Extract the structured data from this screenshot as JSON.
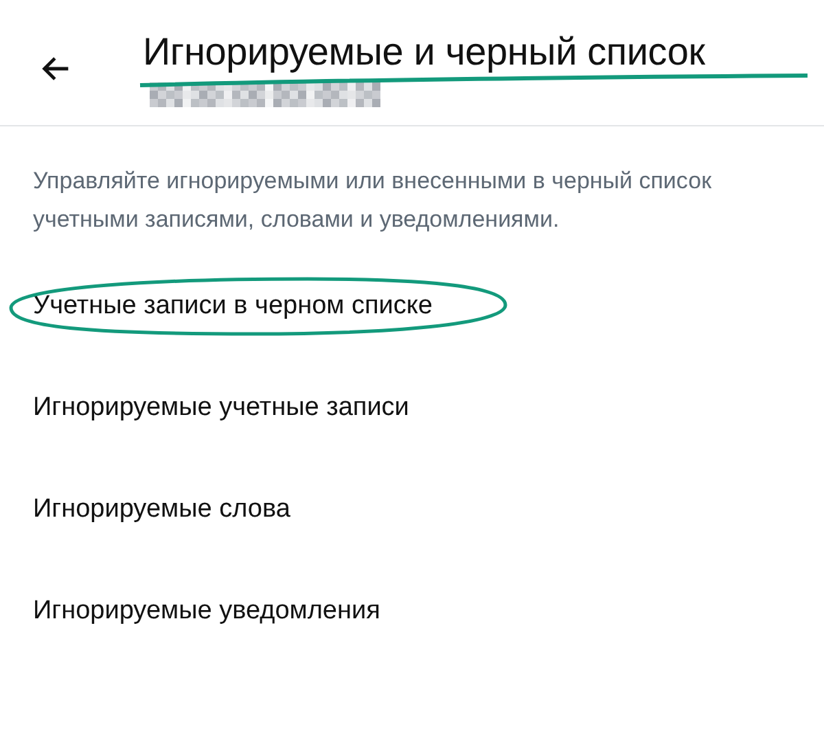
{
  "header": {
    "title": "Игнорируемые и черный список",
    "title_underlined": true
  },
  "description": "Управляйте игнорируемыми или внесенными в черный список учетными записями, словами и уведомлениями.",
  "items": [
    {
      "label": "Учетные записи в черном списке",
      "circled": true
    },
    {
      "label": "Игнорируемые учетные записи",
      "circled": false
    },
    {
      "label": "Игнорируемые слова",
      "circled": false
    },
    {
      "label": "Игнорируемые уведомления",
      "circled": false
    }
  ]
}
